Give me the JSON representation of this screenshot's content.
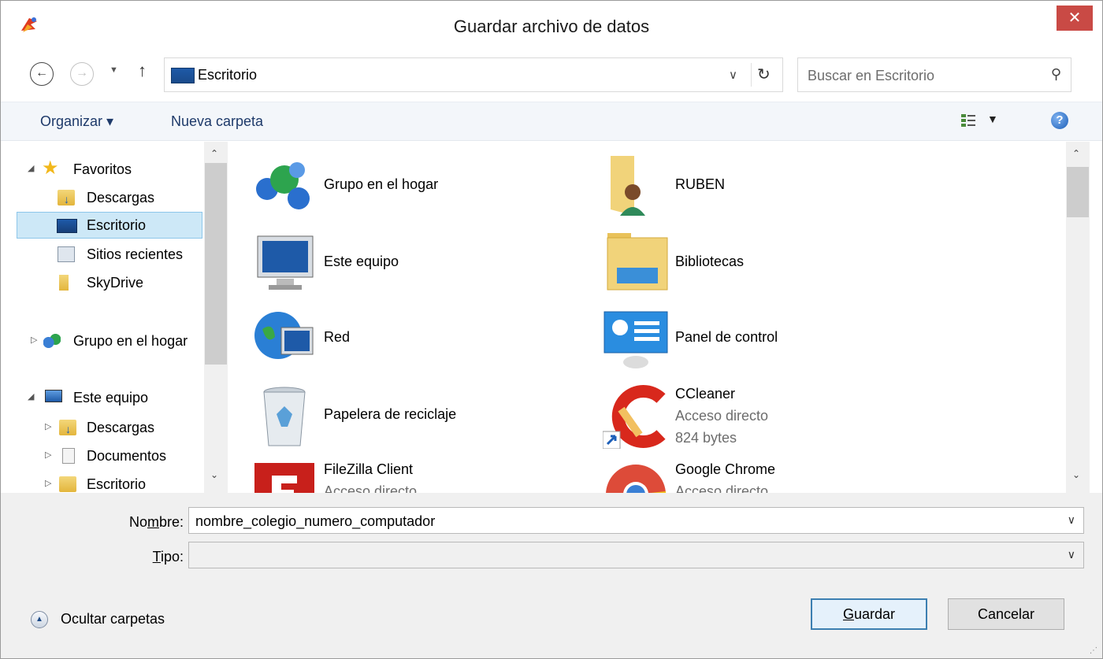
{
  "window": {
    "title": "Guardar archivo de datos",
    "close_label": "✕"
  },
  "address": {
    "location": "Escritorio",
    "search_placeholder": "Buscar en Escritorio"
  },
  "toolbar": {
    "organize_label": "Organizar ▾",
    "new_folder_label": "Nueva carpeta",
    "help_label": "?"
  },
  "navpane": {
    "favorites": "Favoritos",
    "fav_items": [
      "Descargas",
      "Escritorio",
      "Sitios recientes",
      "SkyDrive"
    ],
    "homegroup": "Grupo en el hogar",
    "this_pc": "Este equipo",
    "pc_items": [
      "Descargas",
      "Documentos",
      "Escritorio"
    ]
  },
  "content": {
    "items": [
      {
        "name": "Grupo en el hogar",
        "icon": "homegroup-icon"
      },
      {
        "name": "RUBEN",
        "icon": "user-folder-icon"
      },
      {
        "name": "Este equipo",
        "icon": "computer-icon"
      },
      {
        "name": "Bibliotecas",
        "icon": "libraries-icon"
      },
      {
        "name": "Red",
        "icon": "network-icon"
      },
      {
        "name": "Panel de control",
        "icon": "control-panel-icon"
      },
      {
        "name": "Papelera de reciclaje",
        "icon": "recycle-bin-icon"
      },
      {
        "name": "CCleaner",
        "icon": "ccleaner-icon",
        "type": "Acceso directo",
        "size": "824 bytes"
      },
      {
        "name": "FileZilla Client",
        "icon": "filezilla-icon",
        "type": "Acceso directo"
      },
      {
        "name": "Google Chrome",
        "icon": "chrome-icon",
        "type": "Acceso directo"
      }
    ]
  },
  "form": {
    "name_label_pre": "No",
    "name_label_u": "m",
    "name_label_post": "bre:",
    "name_value": "nombre_colegio_numero_computador",
    "type_label_u": "T",
    "type_label_post": "ipo:",
    "type_value": ""
  },
  "footer": {
    "hide_folders_label": "Ocultar carpetas",
    "save_u": "G",
    "save_rest": "uardar",
    "cancel_label": "Cancelar"
  },
  "colors": {
    "close_bg": "#c94a45",
    "selection_bg": "#cde8f7",
    "link_text": "#1e3a6a"
  }
}
